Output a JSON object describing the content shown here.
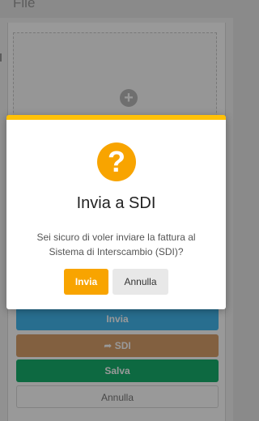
{
  "background": {
    "section_title": "File",
    "buttons": {
      "invia": "Invia",
      "sdi": "SDI",
      "salva": "Salva",
      "annulla": "Annulla"
    },
    "icons": {
      "add": "plus-circle-icon",
      "share": "share-icon"
    }
  },
  "modal": {
    "icon": "question-icon",
    "icon_glyph": "?",
    "title": "Invia a SDI",
    "message": "Sei sicuro di voler inviare la fattura al Sistema di Interscambio (SDI)?",
    "confirm_label": "Invia",
    "cancel_label": "Annulla",
    "accent_color": "#f8a400",
    "top_border_color": "#ffc107"
  }
}
